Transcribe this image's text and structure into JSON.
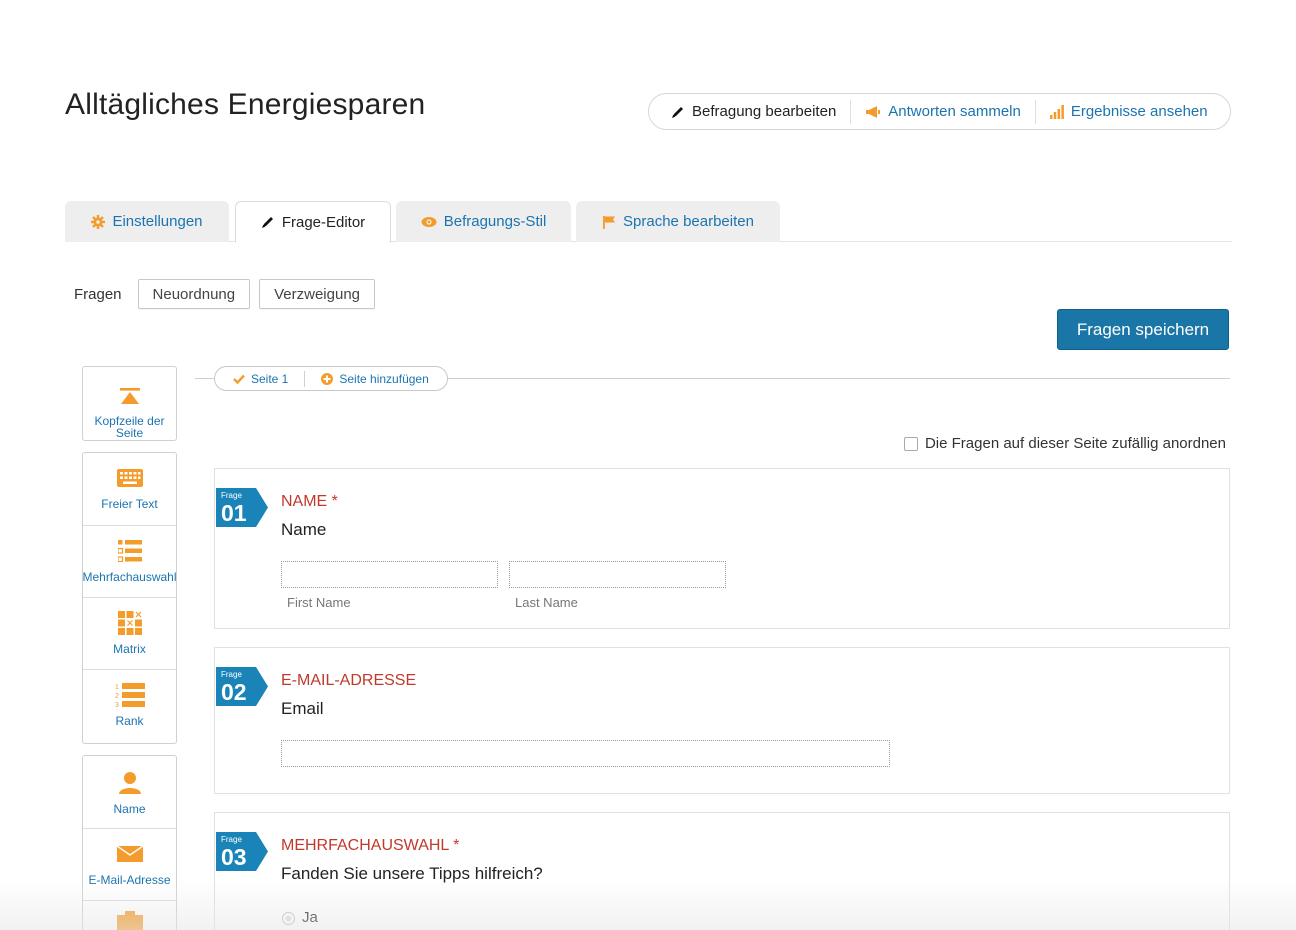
{
  "page_title": "Alltägliches Energiesparen",
  "topnav": {
    "edit": "Befragung bearbeiten",
    "collect": "Antworten sammeln",
    "results": "Ergebnisse ansehen"
  },
  "tabs": {
    "settings": "Einstellungen",
    "editor": "Frage-Editor",
    "style": "Befragungs-Stil",
    "language": "Sprache bearbeiten"
  },
  "subbar": {
    "label": "Fragen",
    "reorder": "Neuordnung",
    "branching": "Verzweigung"
  },
  "save_button": "Fragen speichern",
  "palette": {
    "page_header_line1": "Kopfzeile der",
    "page_header_line2": "Seite",
    "free_text": "Freier Text",
    "multiple_choice": "Mehrfachauswahl",
    "matrix": "Matrix",
    "rank": "Rank",
    "name": "Name",
    "email": "E-Mail-Adresse"
  },
  "page_nav": {
    "page": "Seite 1",
    "add_page": "Seite hinzufügen"
  },
  "randomize_label": "Die Fragen auf dieser Seite zufällig anordnen",
  "questions": [
    {
      "badge_label": "Frage",
      "number": "01",
      "title": "NAME *",
      "text": "Name",
      "first_label": "First Name",
      "last_label": "Last Name"
    },
    {
      "badge_label": "Frage",
      "number": "02",
      "title": "E-MAIL-ADRESSE",
      "text": "Email"
    },
    {
      "badge_label": "Frage",
      "number": "03",
      "title": "MEHRFACHAUSWAHL *",
      "text": "Fanden Sie unsere Tipps hilfreich?",
      "option1": "Ja"
    }
  ],
  "colors": {
    "accent_blue": "#1b74b0",
    "save_blue": "#1976a6",
    "badge_blue": "#1a84b8",
    "icon_orange": "#f39c2c",
    "question_red": "#c0392b"
  }
}
